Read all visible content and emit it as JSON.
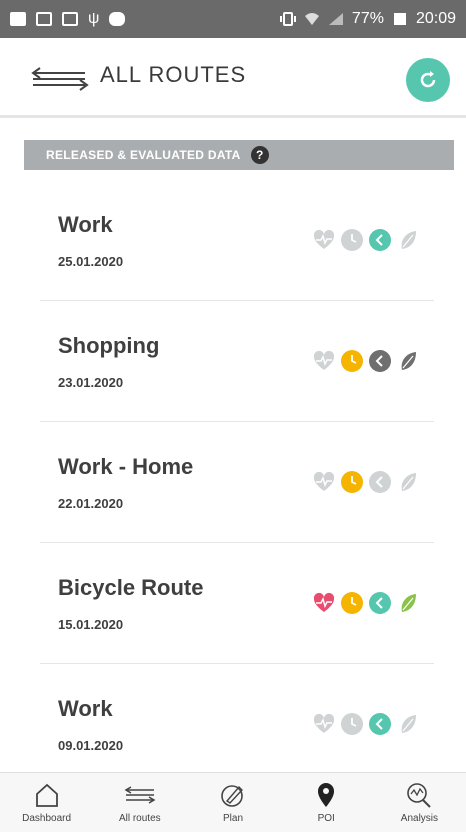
{
  "statusbar": {
    "battery": "77%",
    "time": "20:09"
  },
  "header": {
    "title": "ALL ROUTES"
  },
  "section": {
    "label": "RELEASED & EVALUATED DATA",
    "help": "?"
  },
  "colors": {
    "accent": "#56c7ae",
    "yellow": "#f4b400",
    "red": "#e84c6f",
    "green": "#8bc34a",
    "gray_inactive": "#cfd3d4",
    "gray_dark": "#6f6f6f"
  },
  "routes": [
    {
      "name": "Work",
      "date": "25.01.2020",
      "indicators": {
        "health": "inactive",
        "time": "inactive",
        "speed": "accent",
        "eco": "inactive"
      }
    },
    {
      "name": "Shopping",
      "date": "23.01.2020",
      "indicators": {
        "health": "inactive",
        "time": "yellow",
        "speed": "dark",
        "eco": "dark"
      }
    },
    {
      "name": "Work - Home",
      "date": "22.01.2020",
      "indicators": {
        "health": "inactive",
        "time": "yellow",
        "speed": "inactive",
        "eco": "inactive"
      }
    },
    {
      "name": "Bicycle Route",
      "date": "15.01.2020",
      "indicators": {
        "health": "red",
        "time": "yellow",
        "speed": "accent",
        "eco": "green"
      }
    },
    {
      "name": "Work",
      "date": "09.01.2020",
      "indicators": {
        "health": "inactive",
        "time": "inactive",
        "speed": "accent",
        "eco": "inactive"
      }
    }
  ],
  "nav": [
    {
      "label": "Dashboard",
      "icon": "home-icon"
    },
    {
      "label": "All routes",
      "icon": "routes-icon"
    },
    {
      "label": "Plan",
      "icon": "plan-icon"
    },
    {
      "label": "POI",
      "icon": "location-pin-icon"
    },
    {
      "label": "Analysis",
      "icon": "analysis-icon"
    }
  ]
}
